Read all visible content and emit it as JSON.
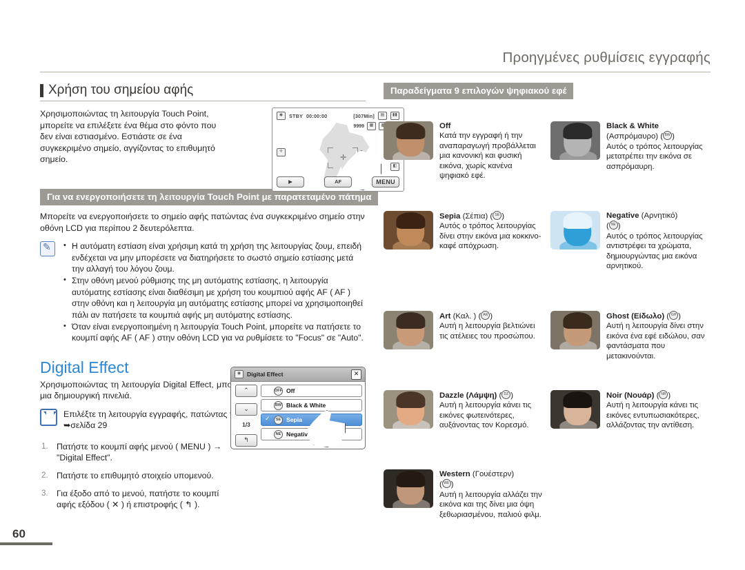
{
  "header": {
    "title": "Προηγμένες ρυθμίσεις εγγραφής"
  },
  "page_number": "60",
  "left": {
    "section_title": "Χρήση του σημείου αφής",
    "intro": "Χρησιμοποιώντας τη λειτουργία Touch Point, μπορείτε να επιλέξετε ένα θέμα στο φόντο που δεν είναι εστιασμένο. Εστιάστε σε ένα συγκεκριμένο σημείο, αγγίζοντας το επιθυμητό σημείο.",
    "ribbon": "Για να ενεργοποιήσετε τη λειτουργία Touch Point με παρατεταμένο πάτημα",
    "ribbon_body": "Μπορείτε να ενεργοποιήσετε το σημείο αφής πατώντας ένα συγκεκριμένο σημείο στην οθόνη LCD για περίπου 2 δευτερόλεπτα.",
    "notes": [
      "Η αυτόματη εστίαση είναι χρήσιμη κατά τη χρήση της λειτουργίας ζουμ, επειδή ενδέχεται να μην μπορέσετε να διατηρήσετε το σωστό σημείο εστίασης μετά την αλλαγή του λόγου ζουμ.",
      "Στην οθόνη μενού ρύθμισης της μη αυτόματης εστίασης, η λειτουργία αυτόματης εστίασης είναι διαθέσιμη με χρήση του κουμπιού αφής AF ( AF ) στην οθόνη και η λειτουργία μη αυτόματης εστίασης μπορεί να χρησιμοποιηθεί πάλι αν πατήσετε τα κουμπιά αφής μη αυτόματης εστίασης.",
      "Όταν είναι ενεργοποιημένη η λειτουργία Touch Point, μπορείτε να πατήσετε το κουμπί αφής AF ( AF ) στην οθόνη LCD για να ρυθμίσετε το \"Focus\" σε \"Auto\"."
    ],
    "digital_effect_heading": "Digital Effect",
    "digital_effect_body": "Χρησιμοποιώντας τη λειτουργία Digital Effect, μπορείτε να δώσετε στις εγγραφές σας μια δημιουργική πινελιά.",
    "tip_text": "Επιλέξτε τη λειτουργία εγγραφής, πατώντας το κουμπί MODE.",
    "tip_ref": "➥σελίδα 29",
    "steps": [
      "Πατήστε το κουμπί αφής μενού ( MENU ) → \"Digital Effect\".",
      "Πατήστε το επιθυμητό στοιχείο υπομενού.",
      "Για έξοδο από το μενού, πατήστε το κουμπί αφής εξόδου ( ✕ ) ή επιστροφής ( ↰ )."
    ]
  },
  "lcd": {
    "status": "STBY",
    "timecode": "00:00:00",
    "remaining": "[307Min]",
    "photo_count": "9999",
    "battery_icon": "battery-icon",
    "card_icon": "memory-card-icon",
    "play_button": "▶",
    "af_button": "AF",
    "menu_button": "MENU"
  },
  "dialog": {
    "title": "Digital Effect",
    "close": "✕",
    "page_indicator": "1/3",
    "up": "⌃",
    "down": "⌄",
    "back": "↰",
    "items": [
      {
        "label": "Off",
        "selected": false
      },
      {
        "label": "Black & White",
        "selected": false
      },
      {
        "label": "Sepia",
        "selected": true
      },
      {
        "label": "Negative",
        "selected": false
      }
    ]
  },
  "right": {
    "ribbon": "Παραδείγματα 9 επιλογών ψηφιακού εφέ",
    "effects": [
      {
        "name": "Off",
        "greek": "",
        "has_icon": false,
        "desc": "Κατά την εγγραφή ή την αναπαραγωγή προβάλλεται μια κανονική και φυσική εικόνα, χωρίς κανένα ψηφιακό εφέ.",
        "thumb": {
          "bg": "#8a8272",
          "hair": "#3d2c1f",
          "face": "#c08f6b",
          "body": "#b9b3ab"
        }
      },
      {
        "name": "Black & White",
        "greek": "(Ασπρόμαυρο)",
        "has_icon": true,
        "desc": "Αυτός ο τρόπος λειτουργίας μετατρέπει την εικόνα σε ασπρόμαυρη.",
        "thumb": {
          "bg": "#6e6e6e",
          "hair": "#2a2a2a",
          "face": "#b4b4b4",
          "body": "#9a9a9a"
        }
      },
      {
        "name": "Sepia",
        "greek": "(Σέπια)",
        "has_icon": true,
        "desc": "Αυτός ο τρόπος λειτουργίας δίνει στην εικόνα μια κοκκινο-καφέ απόχρωση.",
        "thumb": {
          "bg": "#6d4c31",
          "hair": "#3a2313",
          "face": "#c0895a",
          "body": "#a87c52"
        }
      },
      {
        "name": "Negative",
        "greek": "(Αρνητικό)",
        "has_icon": true,
        "desc": "Αυτός ο τρόπος λειτουργίας αντιστρέφει τα χρώματα, δημιουργώντας μια εικόνα αρνητικού.",
        "thumb": {
          "bg": "#cfe4f2",
          "hair": "#e8f4fb",
          "face": "#2f9fd8",
          "body": "#7fc4e6"
        }
      },
      {
        "name": "Art",
        "greek": "(Καλ. )",
        "has_icon": true,
        "desc": "Αυτή η λειτουργία βελτιώνει τις ατέλειες του προσώπου.",
        "thumb": {
          "bg": "#8b8472",
          "hair": "#3b2b20",
          "face": "#c89a78",
          "body": "#b5b0a8"
        }
      },
      {
        "name": "Ghost",
        "greek": "(Είδωλο)",
        "has_icon": true,
        "inline_greek": true,
        "desc": "Αυτή η λειτουργία δίνει στην εικόνα ένα εφέ ειδώλου, σαν φαντάσματα που μετακινούνται.",
        "thumb": {
          "bg": "#7d7466",
          "hair": "#3a2a1e",
          "face": "#c59madd",
          "body": "#b0aaa2"
        }
      },
      {
        "name": "Dazzle",
        "greek": "(Λάμψη)",
        "has_icon": true,
        "inline_greek": true,
        "desc": "Αυτή η λειτουργία κάνει τις εικόνες φωτεινότερες, αυξάνοντας τον Κορεσμό.",
        "thumb": {
          "bg": "#9b9280",
          "hair": "#4a3527",
          "face": "#e2ab84",
          "body": "#c8c2ba"
        }
      },
      {
        "name": "Noir",
        "greek": "(Νουάρ)",
        "has_icon": true,
        "inline_greek": true,
        "desc": "Αυτή η λειτουργία κάνει τις εικόνες εντυπωσιακότερες, αλλάζοντας την αντίθεση.",
        "thumb": {
          "bg": "#3b3630",
          "hair": "#1a1410",
          "face": "#d8b49a",
          "body": "#8e8880"
        }
      },
      {
        "name": "Western",
        "greek": "(Γουέστερν)",
        "has_icon": true,
        "desc": "Αυτή η λειτουργία αλλάζει την εικόνα και της δίνει μια όψη ξεθωριασμένου, παλιού φιλμ.",
        "thumb": {
          "bg": "#2f2a24",
          "hair": "#241a12",
          "face": "#c0977a",
          "body": "#7e7870"
        }
      }
    ]
  }
}
